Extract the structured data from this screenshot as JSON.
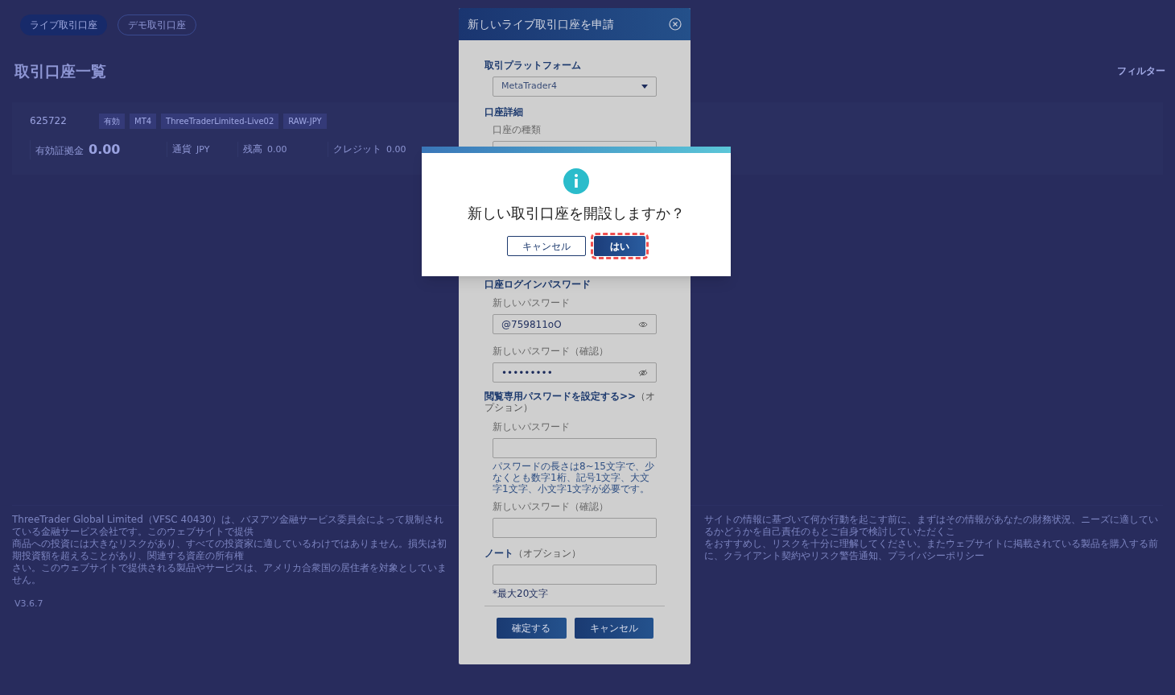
{
  "tabs": [
    {
      "label": "ライブ取引口座",
      "selected": true
    },
    {
      "label": "デモ取引口座",
      "selected": false
    }
  ],
  "page_title": "取引口座一覧",
  "filter_label": "フィルター",
  "account": {
    "number": "625722",
    "tags": [
      "有効",
      "MT4",
      "ThreeTraderLimited-Live02",
      "RAW-JPY"
    ],
    "stats": [
      {
        "label": "有効証拠金",
        "value": "0.00",
        "kind": "large"
      },
      {
        "label": "通貨",
        "value": "JPY",
        "kind": "normal"
      },
      {
        "label": "残高",
        "value": "0.00",
        "kind": "normal"
      },
      {
        "label": "クレジット",
        "value": "0.00",
        "kind": "normal"
      }
    ]
  },
  "footer": {
    "left_lines": [
      "ThreeTrader Global Limited（VFSC 40430）は、バヌアツ金融サービス委員会によって規制されている金融サービス会社です。このウェブサイトで提供",
      "商品への投資には大きなリスクがあり、すべての投資家に適しているわけではありません。損失は初期投資額を超えることがあり、関連する資産の所有権",
      "さい。このウェブサイトで提供される製品やサービスは、アメリカ合衆国の居住者を対象としていません。"
    ],
    "right_lines": [
      "サイトの情報に基づいて何か行動を起こす前に、まずはその情報があなたの財務状況、ニーズに適しているかどうかを自己責任のもとご自身で検討していただくこ",
      "をおすすめし、リスクを十分に理解してください。またウェブサイトに掲載されている製品を購入する前に、クライアント契約やリスク警告通知、プライバシーポリシー"
    ],
    "version": "V3.6.7"
  },
  "form": {
    "title": "新しいライブ取引口座を申請",
    "platform_heading": "取引プラットフォーム",
    "platform_value": "MetaTrader4",
    "details_heading": "口座詳細",
    "account_type_label": "口座の種類",
    "password_heading": "口座ログインパスワード",
    "password_label": "新しいパスワード",
    "password_value": "@759811oO",
    "password_visible": true,
    "confirm_label": "新しいパスワード（確認）",
    "confirm_value": "•••••••••",
    "confirm_visible": false,
    "readonly_link": "閲覧専用パスワードを設定する>>",
    "readonly_suffix": "（オプション）",
    "readonly_label": "新しいパスワード",
    "readonly_hint": "パスワードの長さは8~15文字で、少なくとも数字1桁、記号1文字、大文字1文字、小文字1文字が必要です。",
    "readonly_confirm_label": "新しいパスワード（確認）",
    "note_heading": "ノート",
    "note_suffix": "（オプション）",
    "note_hint": "*最大20文字",
    "buttons": [
      "確定する",
      "キャンセル"
    ]
  },
  "dialog": {
    "message": "新しい取引口座を開設しますか？",
    "cancel": "キャンセル",
    "ok": "はい",
    "ok_highlighted": true
  }
}
